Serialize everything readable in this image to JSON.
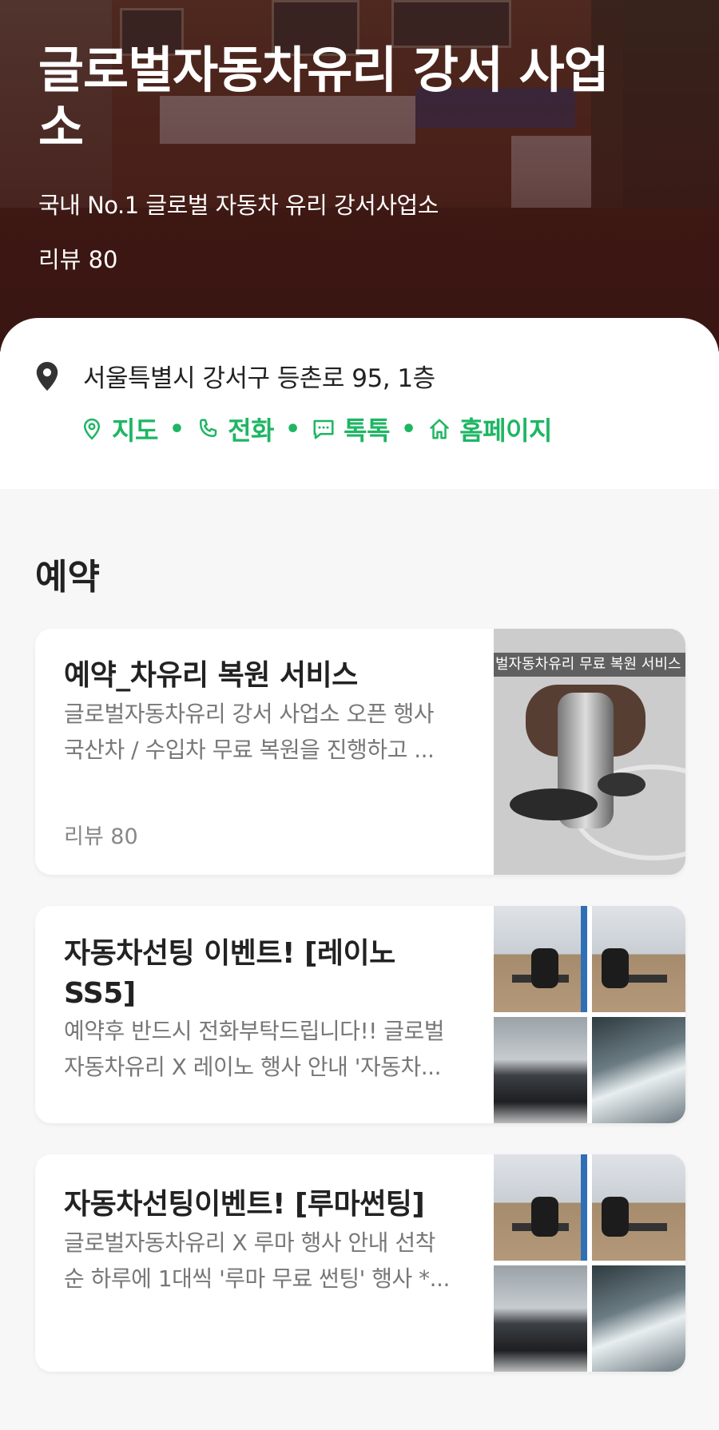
{
  "hero": {
    "title": "글로벌자동차유리 강서 사업소",
    "subtitle": "국내 No.1 글로벌 자동차 유리 강서사업소",
    "review": "리뷰 80"
  },
  "info": {
    "address": "서울특별시 강서구 등촌로 95, 1층",
    "links": {
      "map": "지도",
      "call": "전화",
      "talk": "톡톡",
      "homepage": "홈페이지"
    },
    "accent_color": "#1eb663"
  },
  "section": {
    "title": "예약"
  },
  "cards": [
    {
      "title": "예약_차유리 복원 서비스",
      "desc_line1": "글로벌자동차유리 강서 사업소 오픈 행사",
      "desc_line2": "국산차 / 수입차 무료 복원을 진행하고 ...",
      "review": "리뷰 80",
      "thumb_banner": "벌자동차유리 무료 복원 서비스 C"
    },
    {
      "title": "자동차선팅 이벤트! [레이노 SS5]",
      "desc_line1": "예약후 반드시 전화부탁드립니다!! 글로벌",
      "desc_line2": "자동차유리 X 레이노 행사 안내 '자동차..."
    },
    {
      "title": "자동차선팅이벤트! [루마썬팅]",
      "desc_line1": "글로벌자동차유리 X 루마 행사 안내 선착",
      "desc_line2": "순 하루에 1대씩 '루마 무료 썬팅' 행사 *..."
    }
  ]
}
